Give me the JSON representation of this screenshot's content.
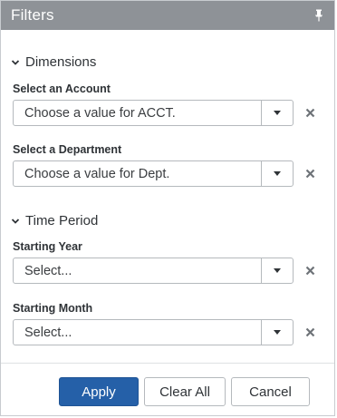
{
  "header": {
    "title": "Filters",
    "pin_icon": "pin-icon"
  },
  "sections": {
    "dimensions": {
      "title": "Dimensions",
      "expanded": true,
      "fields": {
        "account": {
          "label": "Select an Account",
          "placeholder": "Choose a value for ACCT."
        },
        "department": {
          "label": "Select a Department",
          "placeholder": "Choose a value for Dept."
        }
      }
    },
    "time_period": {
      "title": "Time Period",
      "expanded": true,
      "fields": {
        "starting_year": {
          "label": "Starting Year",
          "placeholder": "Select..."
        },
        "starting_month": {
          "label": "Starting Month",
          "placeholder": "Select..."
        }
      }
    }
  },
  "footer": {
    "apply_label": "Apply",
    "clear_all_label": "Clear All",
    "cancel_label": "Cancel"
  },
  "colors": {
    "header_bg": "#8e9297",
    "primary": "#2560a8",
    "clear_icon": "#6e7378"
  }
}
